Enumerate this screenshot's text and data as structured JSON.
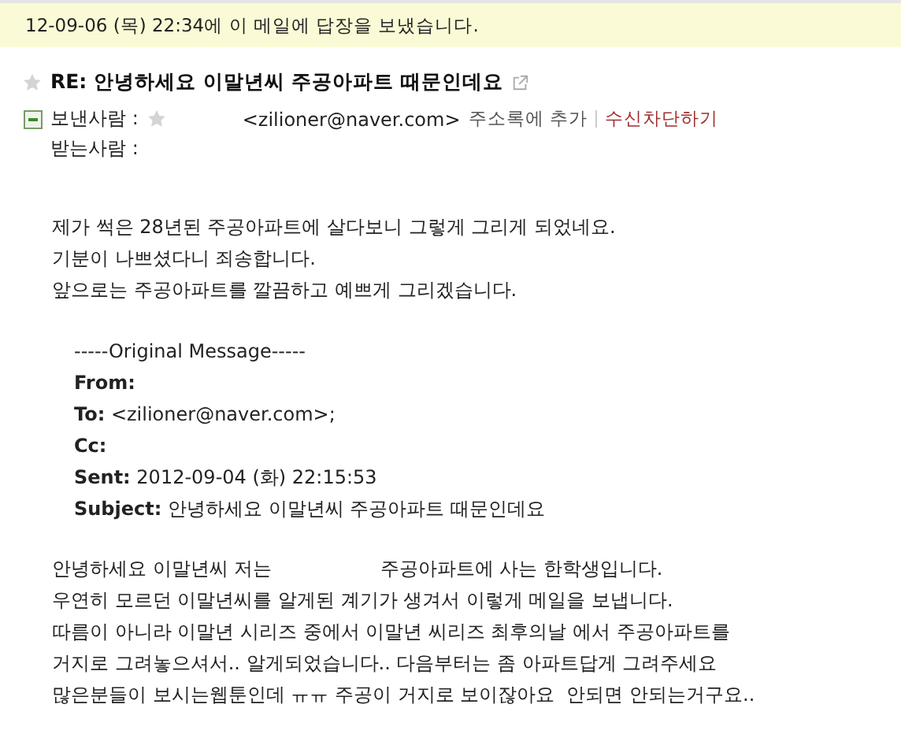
{
  "notice": {
    "text": "12-09-06 (목) 22:34에 이 메일에 답장을 보냈습니다."
  },
  "subject": {
    "text": "RE: 안녕하세요 이말년씨 주공아파트 때문인데요",
    "starred": false
  },
  "sender": {
    "label": "보낸사람 :",
    "starred": false,
    "address": "<zilioner@naver.com>",
    "add_contact": "주소록에 추가",
    "block": "수신차단하기"
  },
  "recipient": {
    "label": "받는사람 :"
  },
  "reply_lines": [
    "제가 썩은 28년된 주공아파트에 살다보니 그렇게 그리게 되었네요.",
    "기분이 나쁘셨다니 죄송합니다.",
    "앞으로는 주공아파트를 깔끔하고 예쁘게 그리겠습니다."
  ],
  "original": {
    "header": "-----Original Message-----",
    "fields": [
      {
        "label": "From:"
      },
      {
        "label": "To:",
        "value": "<zilioner@naver.com>;"
      },
      {
        "label": "Cc:"
      },
      {
        "label": "Sent:",
        "value": "2012-09-04 (화) 22:15:53"
      },
      {
        "label": "Subject:",
        "value": "안녕하세요 이말년씨 주공아파트 때문인데요"
      }
    ]
  },
  "quoted_lines": [
    "안녕하세요 이말년씨 저는                  주공아파트에 사는 한학생입니다.",
    "우연히 모르던 이말년씨를 알게된 계기가 생겨서 이렇게 메일을 보냅니다.",
    "따름이 아니라 이말년 시리즈 중에서 이말년 씨리즈 최후의날 에서 주공아파트를",
    "거지로 그려놓으셔서.. 알게되었습니다.. 다음부터는 좀 아파트답게 그려주세요",
    "많은분들이 보시는웹툰인데 ㅠㅠ 주공이 거지로 보이잖아요  안되면 안되는거구요.."
  ]
}
